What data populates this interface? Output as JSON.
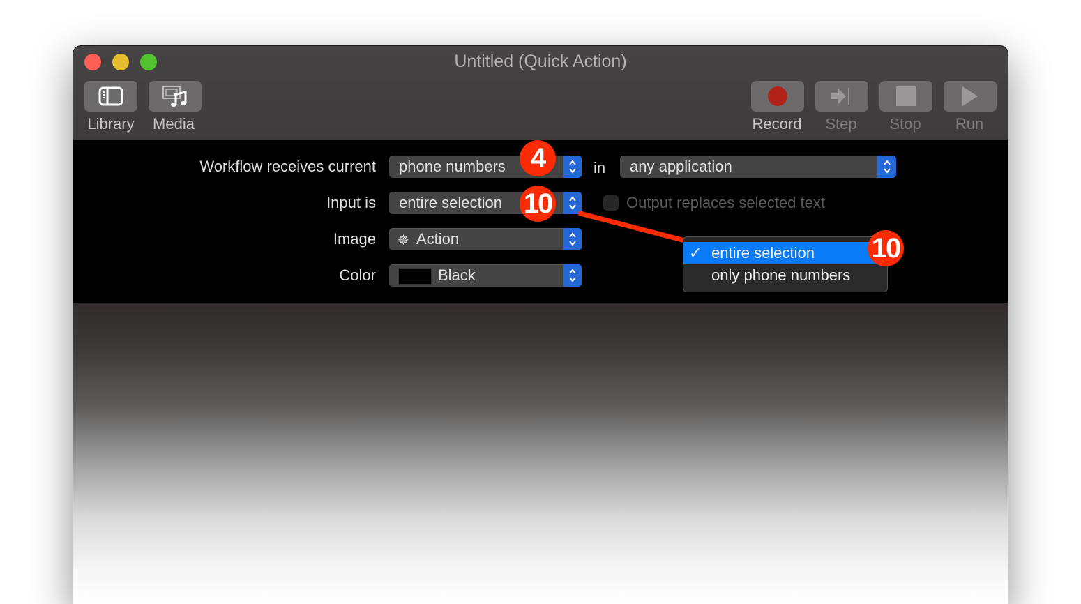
{
  "window": {
    "title": "Untitled (Quick Action)",
    "traffic_lights": {
      "close": "#fe5f57",
      "minimize": "#e6bd2e",
      "maximize": "#52c22e"
    }
  },
  "toolbar": {
    "left": [
      {
        "label": "Library",
        "icon": "library-sidebar-icon"
      },
      {
        "label": "Media",
        "icon": "media-music-icon"
      }
    ],
    "right": [
      {
        "label": "Record",
        "icon": "record-icon",
        "enabled": true
      },
      {
        "label": "Step",
        "icon": "step-icon",
        "enabled": false
      },
      {
        "label": "Stop",
        "icon": "stop-icon",
        "enabled": false
      },
      {
        "label": "Run",
        "icon": "run-icon",
        "enabled": false
      }
    ]
  },
  "workflow": {
    "receives_label": "Workflow receives current",
    "receives_value": "phone numbers",
    "in_label": "in",
    "application_value": "any application",
    "input_label": "Input is",
    "input_value": "entire selection",
    "output_checkbox_label": "Output replaces selected text",
    "output_checkbox_checked": false,
    "image_label": "Image",
    "image_value": "Action",
    "color_label": "Color",
    "color_value": "Black",
    "color_swatch": "#000000"
  },
  "input_menu": {
    "options": [
      {
        "label": "entire selection",
        "selected": true
      },
      {
        "label": "only phone numbers",
        "selected": false
      }
    ]
  },
  "annotations": {
    "badge_receives": "4",
    "badge_input": "10",
    "badge_menu": "10",
    "color": "#fb2b05"
  },
  "colors": {
    "accent": "#2467d5",
    "menu_highlight": "#0a7bf7",
    "record": "#b02218"
  }
}
